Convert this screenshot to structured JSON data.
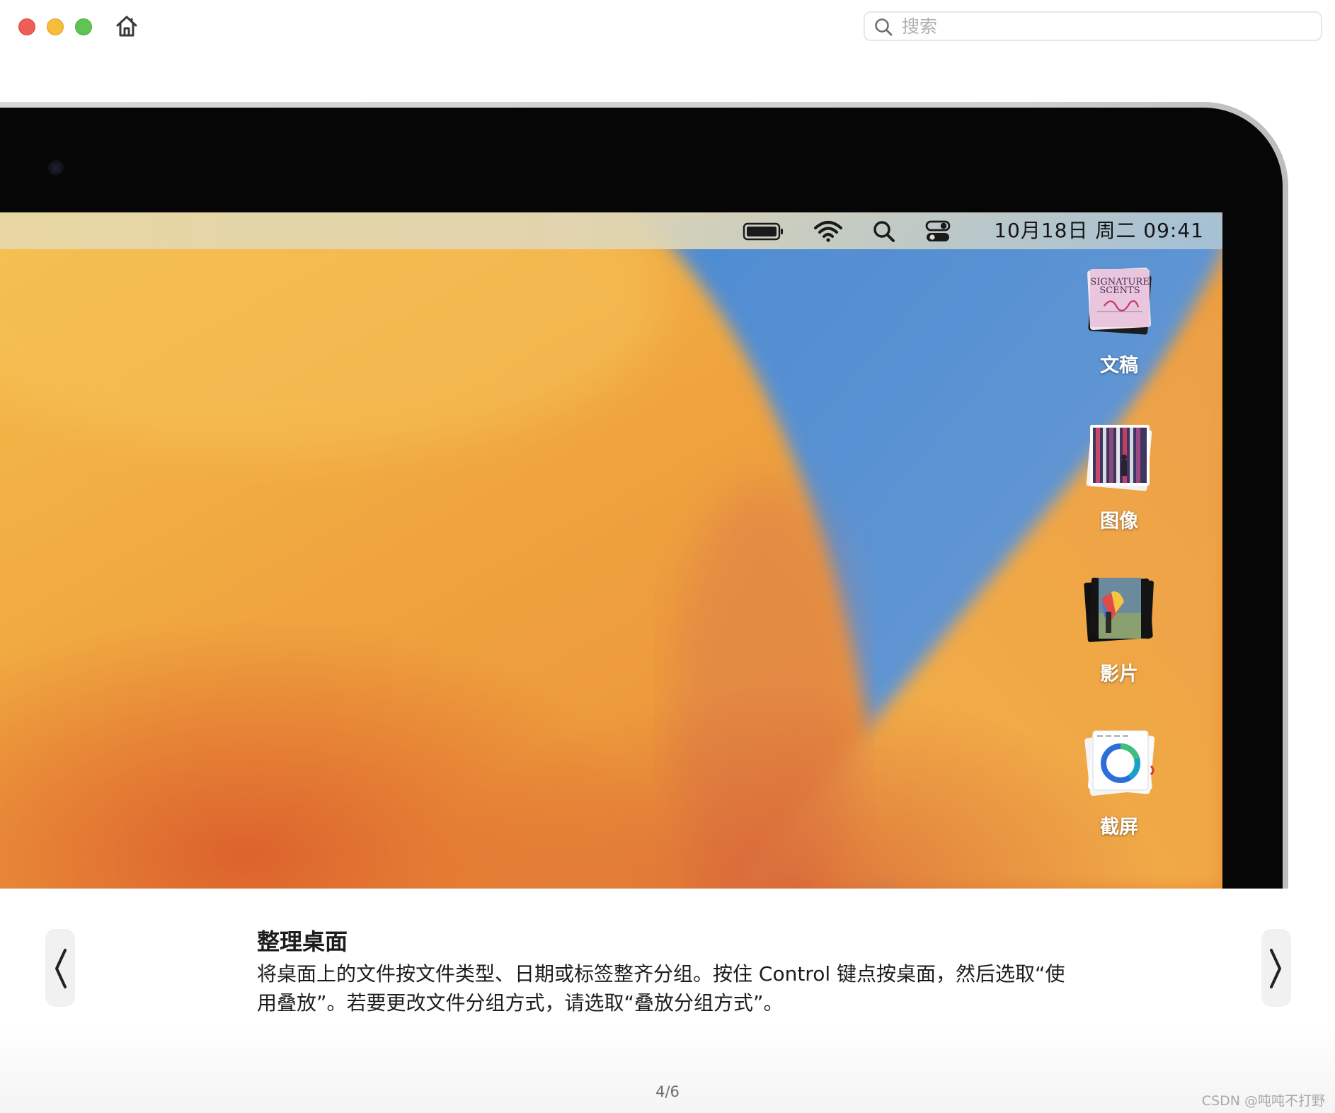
{
  "window": {
    "controls": [
      "close",
      "minimize",
      "zoom"
    ]
  },
  "toolbar": {
    "home_icon": "house-icon",
    "search_placeholder": "搜索",
    "search_value": ""
  },
  "illustration": {
    "menubar": {
      "icons": [
        "battery-icon",
        "wifi-icon",
        "spotlight-search-icon",
        "control-center-icon"
      ],
      "clock": "10月18日 周二  09:41"
    },
    "stacks": [
      {
        "label": "文稿",
        "icon": "documents-stack-icon",
        "thumb_text": "SIGNATURE SCENTS"
      },
      {
        "label": "图像",
        "icon": "images-stack-icon"
      },
      {
        "label": "影片",
        "icon": "movies-stack-icon"
      },
      {
        "label": "截屏",
        "icon": "screenshots-stack-icon"
      }
    ],
    "colors": {
      "wallpaper_orange": "#f0a34a",
      "wallpaper_blue": "#5b8fce",
      "bezel": "#060606"
    }
  },
  "caption": {
    "title": "整理桌面",
    "body": "将桌面上的文件按文件类型、日期或标签整齐分组。按住 Control 键点按桌面，然后选取“使用叠放”。若要更改文件分组方式，请选取“叠放分组方式”。",
    "prev_icon": "chevron-left-icon",
    "next_icon": "chevron-right-icon"
  },
  "pager": {
    "text": "4/6"
  },
  "watermark": "CSDN @吨吨不打野"
}
